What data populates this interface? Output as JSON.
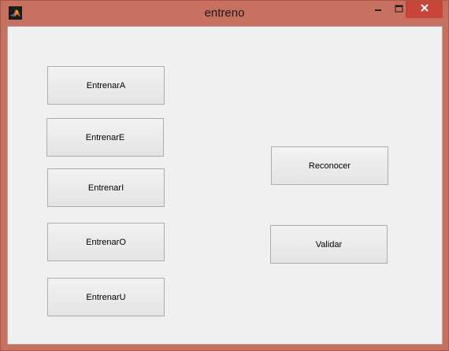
{
  "window": {
    "title": "entreno",
    "icon": "matlab-icon",
    "controls": {
      "minimize_icon": "minimize-icon",
      "maximize_icon": "maximize-icon",
      "close_icon": "close-icon"
    },
    "frame_color": "#c8705f",
    "close_color": "#c7463a"
  },
  "buttons": {
    "entrenar_a": "EntrenarA",
    "entrenar_e": "EntrenarE",
    "entrenar_i": "EntrenarI",
    "entrenar_o": "EntrenarO",
    "entrenar_u": "EntrenarU",
    "reconocer": "Reconocer",
    "validar": "Validar"
  }
}
